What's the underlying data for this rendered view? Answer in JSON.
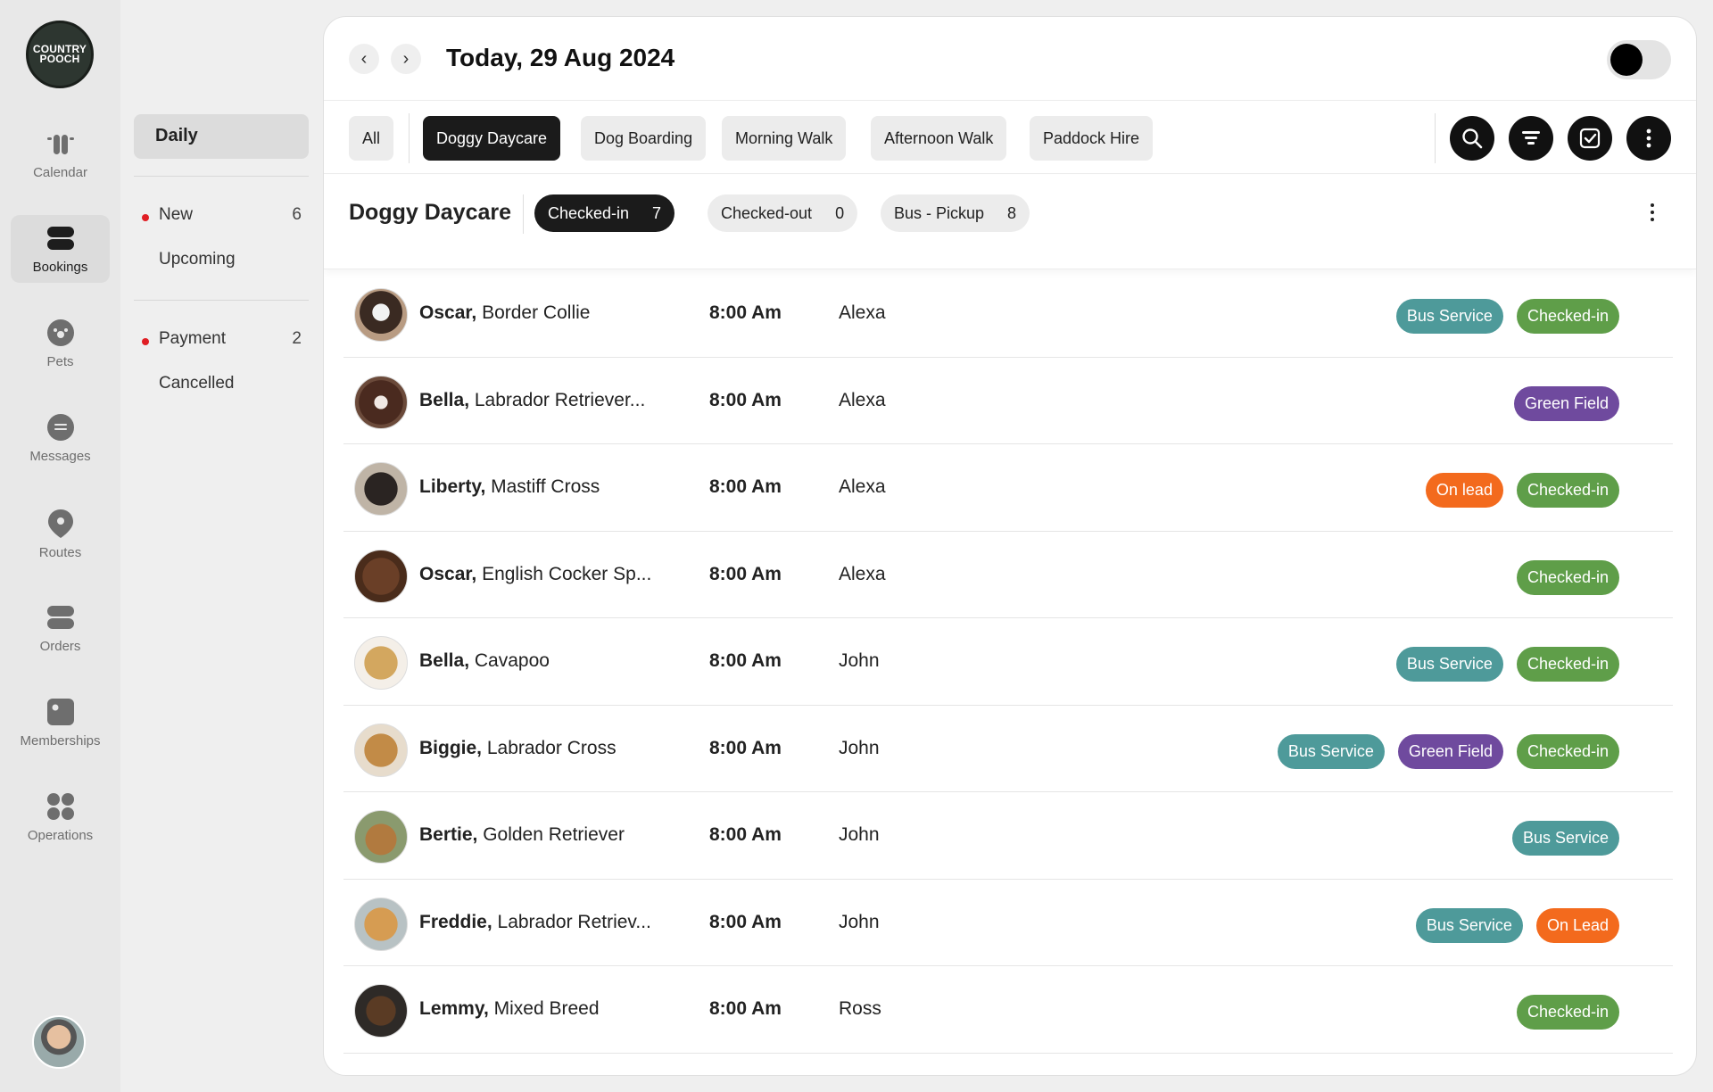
{
  "logo": {
    "line1": "COUNTRY",
    "line2": "POOCH"
  },
  "rail": [
    {
      "label": "Calendar",
      "icon": "calendar-icon",
      "active": false
    },
    {
      "label": "Bookings",
      "icon": "bookings-icon",
      "active": true
    },
    {
      "label": "Pets",
      "icon": "paw-icon",
      "active": false
    },
    {
      "label": "Messages",
      "icon": "message-icon",
      "active": false
    },
    {
      "label": "Routes",
      "icon": "location-pin-icon",
      "active": false
    },
    {
      "label": "Orders",
      "icon": "orders-icon",
      "active": false
    },
    {
      "label": "Memberships",
      "icon": "membership-card-icon",
      "active": false
    },
    {
      "label": "Operations",
      "icon": "grid-icon",
      "active": false
    }
  ],
  "submenu": {
    "daily": "Daily",
    "new": {
      "label": "New",
      "count": "6"
    },
    "upcoming": "Upcoming",
    "payment": {
      "label": "Payment",
      "count": "2"
    },
    "cancelled": "Cancelled"
  },
  "header": {
    "date": "Today, 29 Aug 2024",
    "prev": "‹",
    "next": "›"
  },
  "tabs": [
    "All",
    "Doggy Daycare",
    "Dog Boarding",
    "Morning Walk",
    "Afternoon Walk",
    "Paddock Hire"
  ],
  "section": {
    "title": "Doggy Daycare",
    "chips": [
      {
        "label": "Checked-in",
        "count": "7"
      },
      {
        "label": "Checked-out",
        "count": "0"
      },
      {
        "label": "Bus - Pickup",
        "count": "8"
      }
    ]
  },
  "colors": {
    "bus_service": "#4e9a9a",
    "checked_in": "#5f9e49",
    "green_field": "#6f4a9e",
    "on_lead": "#f36a1d"
  },
  "bookings": [
    {
      "name": "Oscar,",
      "breed": "Border Collie",
      "time": "8:00 Am",
      "staff": "Alexa",
      "tags": [
        "Bus Service",
        "Checked-in"
      ]
    },
    {
      "name": "Bella,",
      "breed": "Labrador Retriever...",
      "time": "8:00 Am",
      "staff": "Alexa",
      "tags": [
        "Green Field"
      ]
    },
    {
      "name": "Liberty,",
      "breed": "Mastiff Cross",
      "time": "8:00 Am",
      "staff": "Alexa",
      "tags": [
        "On lead",
        "Checked-in"
      ]
    },
    {
      "name": "Oscar,",
      "breed": "English Cocker Sp...",
      "time": "8:00 Am",
      "staff": "Alexa",
      "tags": [
        "Checked-in"
      ]
    },
    {
      "name": "Bella,",
      "breed": "Cavapoo",
      "time": "8:00 Am",
      "staff": "John",
      "tags": [
        "Bus Service",
        "Checked-in"
      ]
    },
    {
      "name": "Biggie,",
      "breed": "Labrador Cross",
      "time": "8:00 Am",
      "staff": "John",
      "tags": [
        "Bus Service",
        "Green Field",
        "Checked-in"
      ]
    },
    {
      "name": "Bertie,",
      "breed": "Golden Retriever",
      "time": "8:00 Am",
      "staff": "John",
      "tags": [
        "Bus Service"
      ]
    },
    {
      "name": "Freddie,",
      "breed": "Labrador Retriev...",
      "time": "8:00 Am",
      "staff": "John",
      "tags": [
        "Bus Service",
        "On Lead"
      ]
    },
    {
      "name": "Lemmy,",
      "breed": "Mixed Breed",
      "time": "8:00 Am",
      "staff": "Ross",
      "tags": [
        "Checked-in"
      ]
    }
  ]
}
